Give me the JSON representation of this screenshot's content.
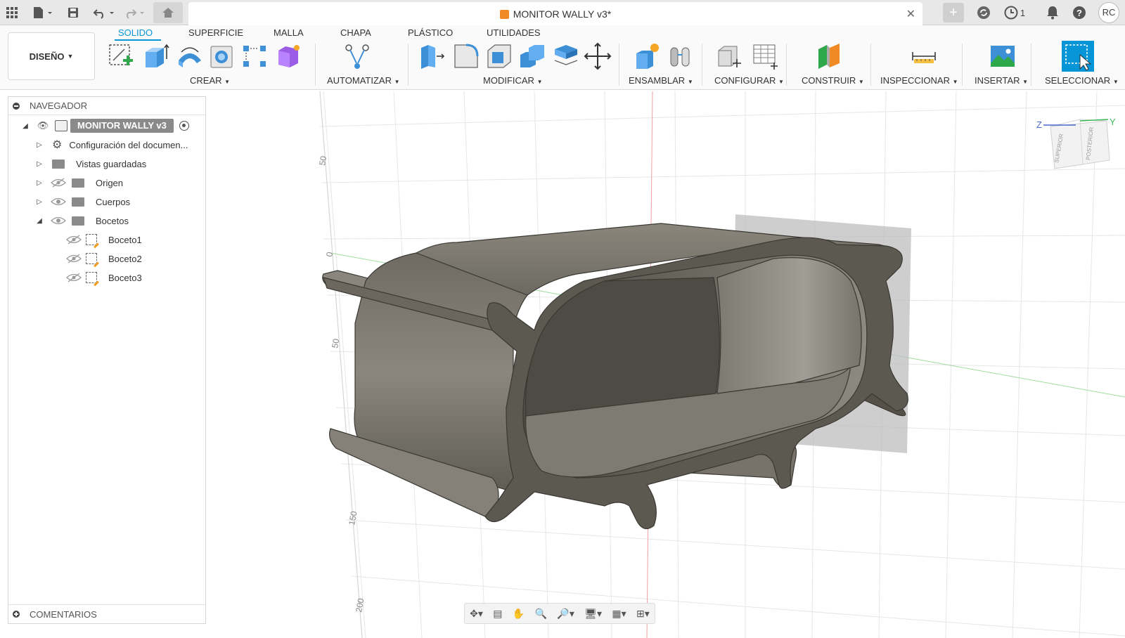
{
  "titlebar": {
    "document_title": "MONITOR WALLY v3*",
    "jobs_count": "1",
    "user_initials": "RC",
    "icons": [
      "app-grid-icon",
      "file-icon",
      "save-icon",
      "undo-icon",
      "redo-icon",
      "home-icon",
      "close-icon",
      "new-tab-icon",
      "sync-icon",
      "job-status-icon",
      "notification-icon",
      "help-icon"
    ]
  },
  "toolbar": {
    "workspace_label": "DISEÑO",
    "tabs": [
      "SOLIDO",
      "SUPERFICIE",
      "MALLA",
      "CHAPA",
      "PLÁSTICO",
      "UTILIDADES"
    ],
    "active_tab": "SOLIDO",
    "groups": {
      "crear": "CREAR",
      "automatizar": "AUTOMATIZAR",
      "modificar": "MODIFICAR",
      "ensamblar": "ENSAMBLAR",
      "configurar": "CONFIGURAR",
      "construir": "CONSTRUIR",
      "inspeccionar": "INSPECCIONAR",
      "insertar": "INSERTAR",
      "seleccionar": "SELECCIONAR"
    },
    "accent": "#0696d7"
  },
  "navigator": {
    "title": "NAVEGADOR",
    "root": "MONITOR WALLY v3",
    "items": [
      {
        "label": "Configuración del documen..."
      },
      {
        "label": "Vistas guardadas"
      },
      {
        "label": "Origen"
      },
      {
        "label": "Cuerpos"
      },
      {
        "label": "Bocetos"
      }
    ],
    "sketches": [
      "Boceto1",
      "Boceto2",
      "Boceto3"
    ]
  },
  "comments": {
    "label": "COMENTARIOS"
  },
  "viewport": {
    "ruler_labels": [
      "50",
      "0",
      "50",
      "150",
      "200"
    ],
    "viewcube_faces": [
      "SUPERIOR",
      "POSTERIOR"
    ],
    "axis_labels": [
      "Z",
      "Y"
    ]
  }
}
